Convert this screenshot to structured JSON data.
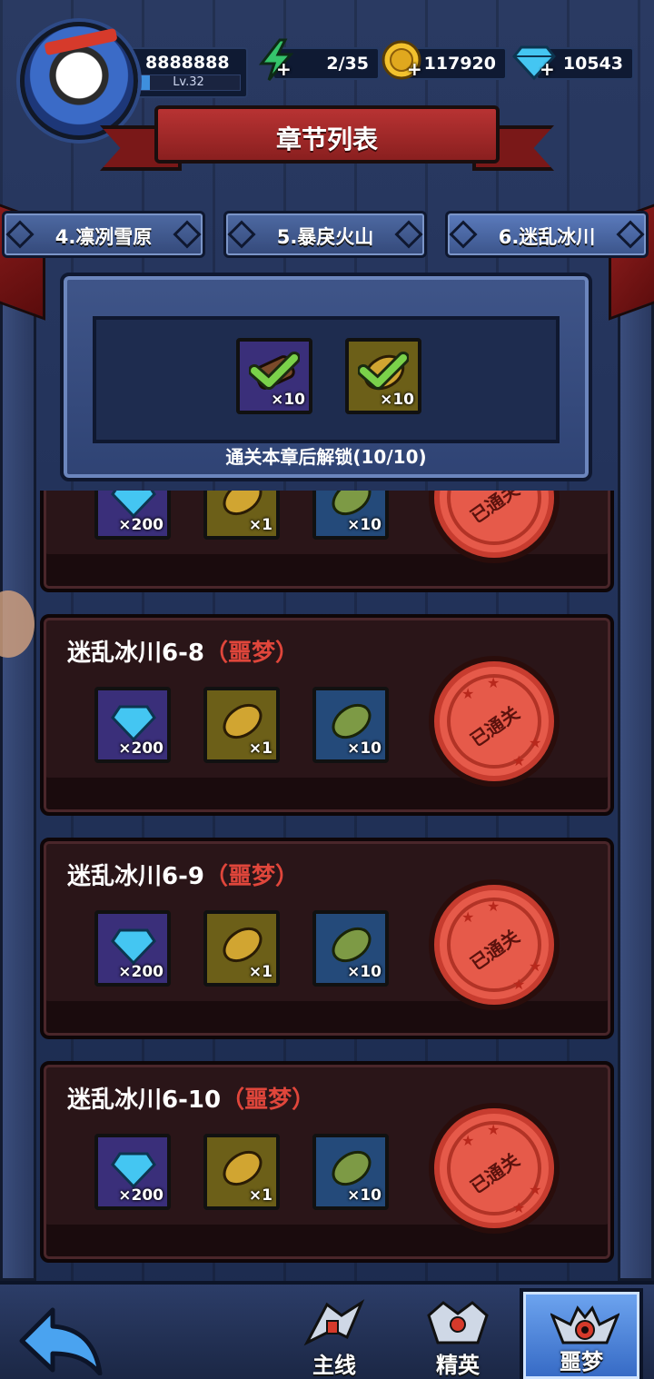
{
  "player": {
    "id": "8888888",
    "level": "Lv.32",
    "xp_fraction": 0.12
  },
  "resources": [
    {
      "name": "energy",
      "icon": "lightning-icon",
      "value": "2/35",
      "color": "#35c46b"
    },
    {
      "name": "gold",
      "icon": "gold-coin-icon",
      "value": "117920",
      "color": "#f2c12e"
    },
    {
      "name": "diamond",
      "icon": "diamond-icon",
      "value": "10543",
      "color": "#44c6f2"
    }
  ],
  "header": {
    "title": "章节列表"
  },
  "chapter_tabs": [
    {
      "label": "4.凛冽雪原",
      "active": false
    },
    {
      "label": "5.暴戾火山",
      "active": false
    },
    {
      "label": "6.迷乱冰川",
      "active": true
    }
  ],
  "unlock": {
    "rewards": [
      {
        "icon": "sword-item-icon",
        "count": "×10",
        "claimed": true
      },
      {
        "icon": "gold-leaf-icon",
        "count": "×10",
        "claimed": true
      }
    ],
    "text": "通关本章后解锁(10/10)"
  },
  "levels": [
    {
      "title": "",
      "difficulty": "",
      "rewards": [
        {
          "icon": "diamond-icon",
          "count": "×200"
        },
        {
          "icon": "gold-leaf-icon",
          "count": "×1"
        },
        {
          "icon": "green-leaf-icon",
          "count": "×10"
        }
      ],
      "stamp": "已通关"
    },
    {
      "title": "迷乱冰川6-8",
      "difficulty": "（噩梦）",
      "rewards": [
        {
          "icon": "diamond-icon",
          "count": "×200"
        },
        {
          "icon": "gold-leaf-icon",
          "count": "×1"
        },
        {
          "icon": "green-leaf-icon",
          "count": "×10"
        }
      ],
      "stamp": "已通关"
    },
    {
      "title": "迷乱冰川6-9",
      "difficulty": "（噩梦）",
      "rewards": [
        {
          "icon": "diamond-icon",
          "count": "×200"
        },
        {
          "icon": "gold-leaf-icon",
          "count": "×1"
        },
        {
          "icon": "green-leaf-icon",
          "count": "×10"
        }
      ],
      "stamp": "已通关"
    },
    {
      "title": "迷乱冰川6-10",
      "difficulty": "（噩梦）",
      "rewards": [
        {
          "icon": "diamond-icon",
          "count": "×200"
        },
        {
          "icon": "gold-leaf-icon",
          "count": "×1"
        },
        {
          "icon": "green-leaf-icon",
          "count": "×10"
        }
      ],
      "stamp": "已通关"
    }
  ],
  "bottom_nav": {
    "back_icon": "back-arrow-icon",
    "tabs": [
      {
        "label": "主线",
        "icon": "main-line-icon",
        "active": false
      },
      {
        "label": "精英",
        "icon": "elite-icon",
        "active": false
      },
      {
        "label": "噩梦",
        "icon": "nightmare-icon",
        "active": true
      }
    ]
  }
}
